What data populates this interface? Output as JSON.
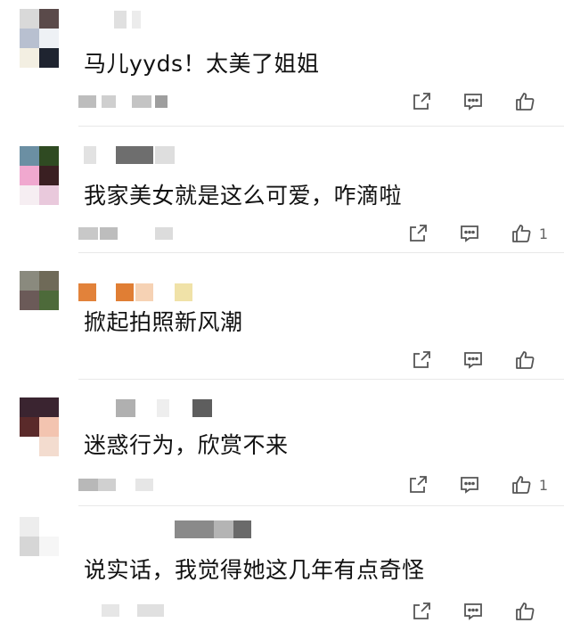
{
  "comments": [
    {
      "text": "马儿yyds！太美了姐姐",
      "likes": ""
    },
    {
      "text": "我家美女就是这么可爱，咋滴啦",
      "likes": "1"
    },
    {
      "text": "掀起拍照新风潮",
      "likes": ""
    },
    {
      "text": "迷惑行为，欣赏不来",
      "likes": "1"
    },
    {
      "text": "说实话，我觉得她这几年有点奇怪",
      "likes": ""
    }
  ],
  "icons": {
    "share": "share-icon",
    "reply": "comment-icon",
    "like": "thumbs-up-icon"
  },
  "colors": {
    "icon": "#555555",
    "text": "#111111",
    "divider": "#e8e8e8"
  }
}
